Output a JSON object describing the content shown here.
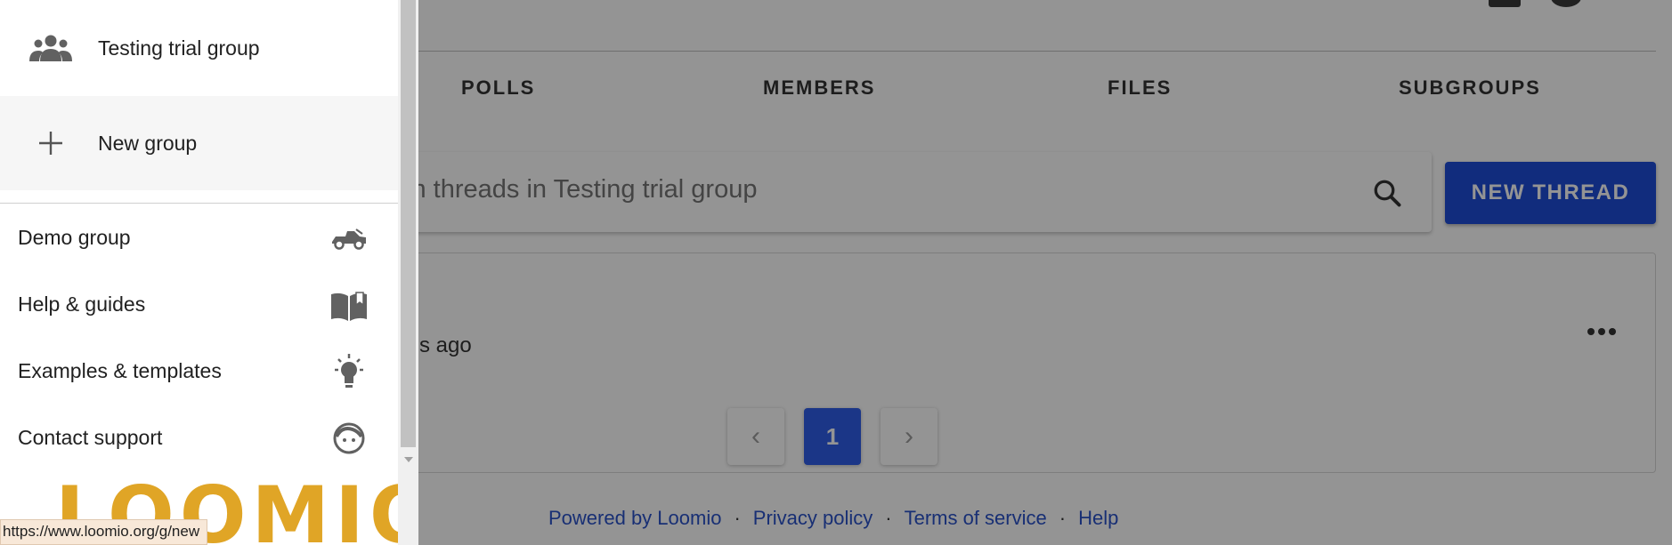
{
  "drawer": {
    "group_label": "Testing trial group",
    "new_group_label": "New group",
    "links": [
      {
        "label": "Demo group",
        "icon": "car-icon"
      },
      {
        "label": "Help & guides",
        "icon": "book-icon"
      },
      {
        "label": "Examples & templates",
        "icon": "lightbulb-icon"
      },
      {
        "label": "Contact support",
        "icon": "support-agent-icon"
      }
    ],
    "logo_text": "LOOMIO."
  },
  "tabs": [
    "POLLS",
    "MEMBERS",
    "FILES",
    "SUBGROUPS"
  ],
  "search": {
    "placeholder": "ch threads in Testing trial group"
  },
  "new_thread_label": "NEW THREAD",
  "thread": {
    "time": "s ago"
  },
  "pager": {
    "prev": "‹",
    "current": "1",
    "next": "›"
  },
  "footer": {
    "powered": "Powered by Loomio",
    "privacy": "Privacy policy",
    "terms": "Terms of service",
    "help": "Help",
    "separator": "·"
  },
  "status_url": "https://www.loomio.org/g/new",
  "colors": {
    "accent": "#1e4cd8",
    "logo": "#e0a526",
    "link": "#2a52c9"
  }
}
